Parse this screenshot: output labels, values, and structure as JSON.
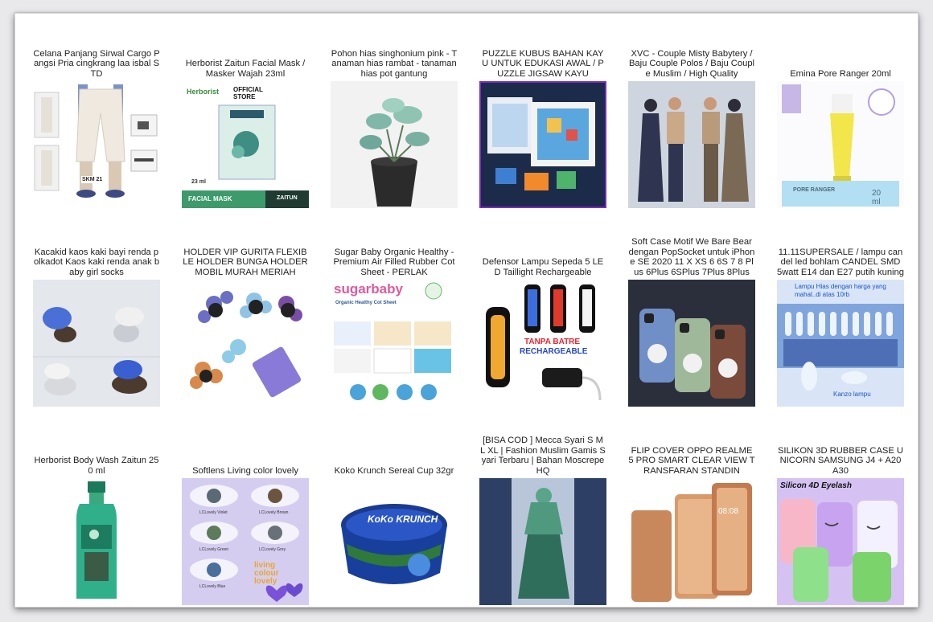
{
  "products": [
    {
      "title": "Celana Panjang Sirwal Cargo Pangsi Pria cingkrang laa isbal STD",
      "image_text": {
        "label": "SKM 21"
      }
    },
    {
      "title": "Herborist Zaitun Facial Mask / Masker Wajah 23ml",
      "image_text": {
        "brand": "Herborist",
        "store": "OFFICIAL STORE",
        "size": "23 ml",
        "type": "FACIAL MASK",
        "variant": "ZAITUN"
      }
    },
    {
      "title": "Pohon hias singhonium pink - Tanaman hias rambat - tanaman hias pot gantung",
      "image_text": {}
    },
    {
      "title": "PUZZLE KUBUS BAHAN KAYU UNTUK EDUKASI AWAL / PUZZLE JIGSAW KAYU",
      "image_text": {}
    },
    {
      "title": "XVC - Couple Misty Babytery / Baju Couple Polos / Baju Couple Muslim / High Quality",
      "image_text": {}
    },
    {
      "title": "Emina Pore Ranger 20ml",
      "image_text": {
        "product": "PORE RANGER",
        "size": "20 ml"
      }
    },
    {
      "title": "Kacakid kaos kaki bayi renda polkadot Kaos kaki renda anak baby girl socks",
      "image_text": {}
    },
    {
      "title": "HOLDER VIP GURITA FLEXIBLE  HOLDER BUNGA HOLDER MOBIL MURAH MERIAH",
      "image_text": {}
    },
    {
      "title": "Sugar Baby Organic Healthy - Premium Air Filled Rubber Cot Sheet - PERLAK",
      "image_text": {
        "brand": "sugarbaby",
        "tagline": "Organic Healthy Cot Sheet"
      }
    },
    {
      "title": "Defensor Lampu Sepeda 5 LED Taillight Rechargeable",
      "image_text": {
        "line1": "TANPA BATRE",
        "line2": "RECHARGEABLE"
      }
    },
    {
      "title": "Soft Case Motif We Bare Bear dengan PopSocket untuk iPhone SE 2020 11 X XS 6 6S 7 8 Plus 6Plus 6SPlus 7Plus 8Plus",
      "image_text": {}
    },
    {
      "title": "11.11SUPERSALE / lampu candel led bohlam CANDEL SMD 5watt E14 dan E27 putih kuning",
      "image_text": {
        "banner": "Lampu Hias dengan harga yang mahal..di atas 10rb",
        "caption": "Kanzo lampu"
      }
    },
    {
      "title": "Herborist Body Wash Zaitun 250 ml",
      "image_text": {}
    },
    {
      "title": "Softlens Living color lovely",
      "image_text": {
        "labels": [
          "LCLovely Violet",
          "LCLovely Brown",
          "LCLovely Green",
          "LCLovely Grey",
          "LCLovely Blue"
        ],
        "logo": "living colour lovely"
      }
    },
    {
      "title": "Koko Krunch Sereal Cup 32gr",
      "image_text": {
        "brand": "KoKo KRUNCH"
      }
    },
    {
      "title": "[BISA COD ] Mecca Syari S M L XL | Fashion Muslim Gamis Syari Terbaru | Bahan Moscrepe HQ",
      "image_text": {}
    },
    {
      "title": "FLIP COVER OPPO REALME 5 PRO SMART CLEAR VIEW TRANSFARAN STANDIN",
      "image_text": {
        "clock": "08:08"
      }
    },
    {
      "title": "SILIKON 3D RUBBER CASE UNICORN SAMSUNG J4 + A20 A30",
      "image_text": {
        "banner": "Silicon 4D Eyelash"
      }
    }
  ],
  "colors": {
    "page_bg": "#e9e9ec",
    "card_bg": "#ffffff",
    "text": "#222222"
  }
}
